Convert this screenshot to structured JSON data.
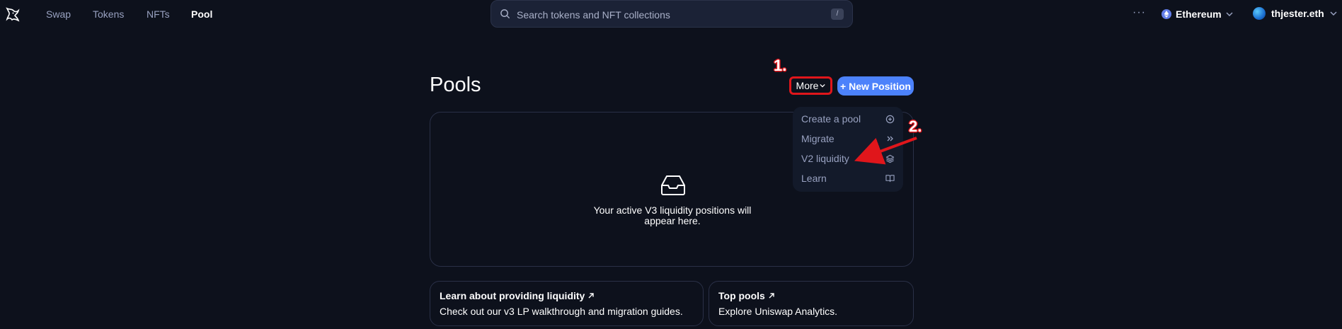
{
  "nav": {
    "links": [
      "Swap",
      "Tokens",
      "NFTs",
      "Pool"
    ],
    "search_placeholder": "Search tokens and NFT collections",
    "search_shortcut": "/",
    "more_dots": "···",
    "network_label": "Ethereum",
    "account_label": "thjester.eth"
  },
  "page": {
    "title": "Pools",
    "more_button": "More",
    "new_position_button": "+ New Position",
    "empty_line1": "Your active V3 liquidity positions will",
    "empty_line2": "appear here."
  },
  "dropdown": {
    "items": [
      {
        "label": "Create a pool",
        "icon": "plus-circle-icon"
      },
      {
        "label": "Migrate",
        "icon": "chevrons-right-icon"
      },
      {
        "label": "V2 liquidity",
        "icon": "layers-icon"
      },
      {
        "label": "Learn",
        "icon": "book-icon"
      }
    ]
  },
  "cards": {
    "learn_title": "Learn about providing liquidity",
    "learn_sub": "Check out our v3 LP walkthrough and migration guides.",
    "top_title": "Top pools",
    "top_sub": "Explore Uniswap Analytics."
  },
  "annotations": {
    "step1": "1.",
    "step2": "2."
  },
  "colors": {
    "background": "#0d111c",
    "accent": "#4c82fb",
    "annotation_red": "#e0161b"
  }
}
